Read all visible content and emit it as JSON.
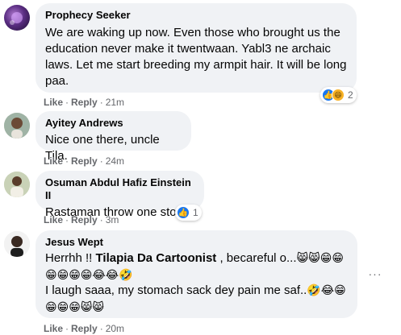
{
  "comments": [
    {
      "author": "Prophecy Seeker",
      "lines": [
        "We are waking up now. Even those who brought us the",
        "education never make it twentwaan. Yabl3 ne archaic",
        "laws. Let me start breeding my armpit hair. It will be long",
        "paa."
      ],
      "like_label": "Like",
      "reply_label": "Reply",
      "time": "21m",
      "reactions_count": "2",
      "reaction_icons": [
        "like-icon",
        "haha-icon"
      ]
    },
    {
      "author": "Ayitey Andrews",
      "lines": [
        "Nice one there, uncle Tila."
      ],
      "like_label": "Like",
      "reply_label": "Reply",
      "time": "24m"
    },
    {
      "author": "Osuman Abdul Hafiz Einstein II",
      "lines": [
        "Rastaman throw one stone"
      ],
      "like_label": "Like",
      "reply_label": "Reply",
      "time": "3m",
      "reactions_count": "1",
      "reaction_icons": [
        "like-icon"
      ]
    },
    {
      "author": "Jesus Wept",
      "line1_prefix": "Herrhh !! ",
      "mention": "Tilapia Da Cartoonist",
      "line1_suffix": " , becareful o...",
      "line1_emojis": "😸😸😁😁",
      "line2_emojis": "😁😁😁😁😂😂🤣",
      "line3_text": "I laugh saaa, my stomach sack dey pain me saf..",
      "line3_emojis": "🤣😂😁",
      "line4_emojis": "😁😁😁😸😸",
      "like_label": "Like",
      "reply_label": "Reply",
      "time": "20m"
    }
  ],
  "separator": "·",
  "more_options": "···"
}
